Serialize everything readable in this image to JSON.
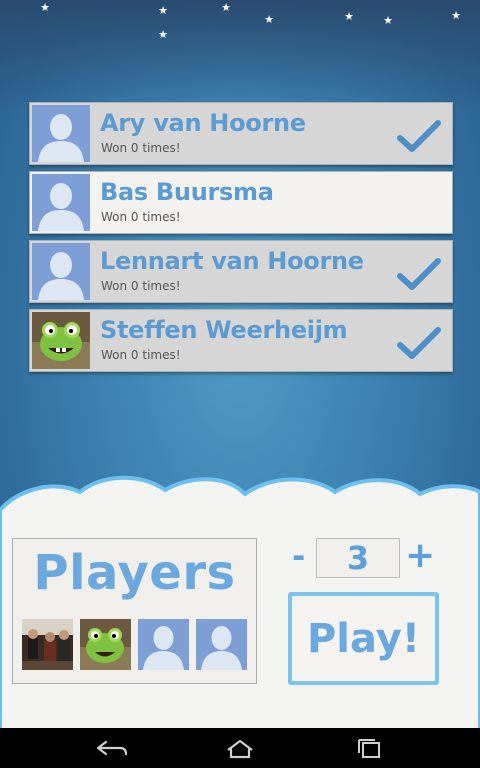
{
  "players": [
    {
      "name": "Ary van Hoorne",
      "wins": "Won 0 times!",
      "selected": true,
      "avatar": "silhouette"
    },
    {
      "name": "Bas Buursma",
      "wins": "Won 0 times!",
      "selected": false,
      "avatar": "silhouette"
    },
    {
      "name": "Lennart van Hoorne",
      "wins": "Won 0 times!",
      "selected": true,
      "avatar": "silhouette"
    },
    {
      "name": "Steffen Weerheijm",
      "wins": "Won 0 times!",
      "selected": true,
      "avatar": "green-monster-photo"
    }
  ],
  "players_panel": {
    "title": "Players",
    "avatars": [
      "group-photo",
      "green-monster-photo",
      "silhouette",
      "silhouette"
    ]
  },
  "count": {
    "minus": "-",
    "value": "3",
    "plus": "+"
  },
  "play_button": {
    "label": "Play!"
  },
  "navbar": {
    "icons": [
      "back-icon",
      "home-icon",
      "recent-apps-icon"
    ]
  },
  "colors": {
    "accent": "#5b9bd2",
    "background": "#3b7fae",
    "checkmark": "#4f8fc8"
  }
}
